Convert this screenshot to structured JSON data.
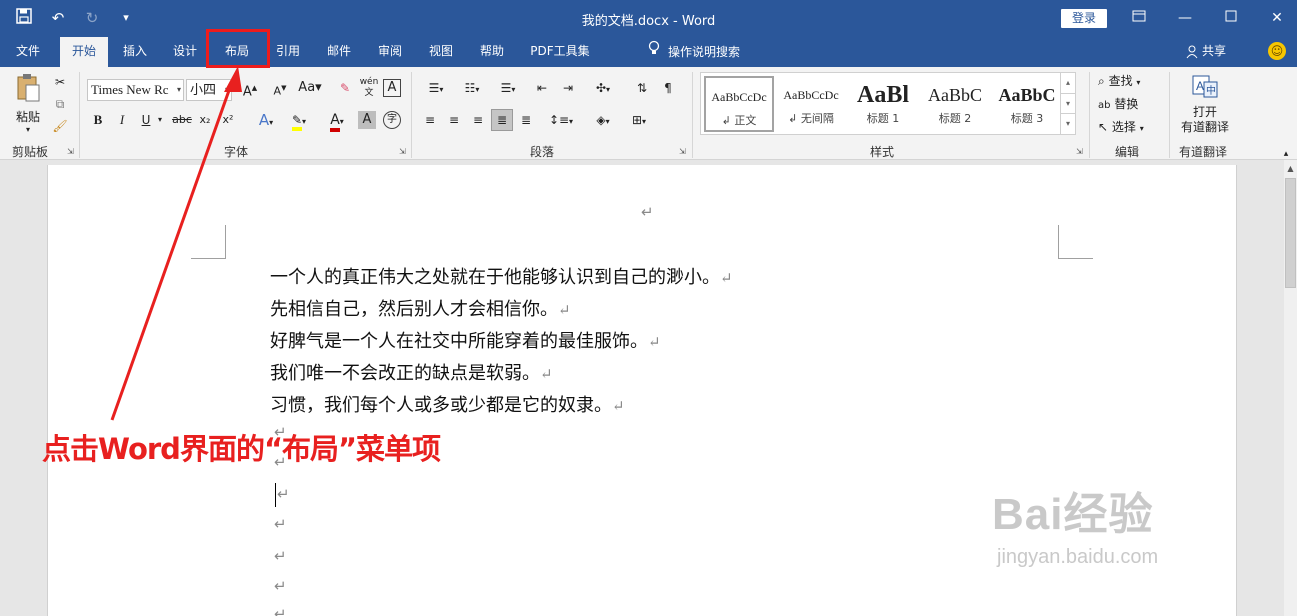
{
  "titlebar": {
    "title": "我的文档.docx  -  Word",
    "login_label": "登录",
    "qat": [
      "save-icon",
      "undo-icon",
      "redo-icon",
      "customize-icon"
    ]
  },
  "tabs": [
    {
      "label": "文件",
      "active": false
    },
    {
      "label": "开始",
      "active": true
    },
    {
      "label": "插入",
      "active": false
    },
    {
      "label": "设计",
      "active": false
    },
    {
      "label": "布局",
      "active": false
    },
    {
      "label": "引用",
      "active": false
    },
    {
      "label": "邮件",
      "active": false
    },
    {
      "label": "审阅",
      "active": false
    },
    {
      "label": "视图",
      "active": false
    },
    {
      "label": "帮助",
      "active": false
    },
    {
      "label": "PDF工具集",
      "active": false
    }
  ],
  "tell_me": "操作说明搜索",
  "share_label": "共享",
  "ribbon": {
    "clipboard": {
      "paste_label": "粘贴",
      "group_label": "剪贴板"
    },
    "font": {
      "font_name": "Times New Rc",
      "font_size": "小四",
      "group_label": "字体",
      "wen_glyph": "wén",
      "wen_char": "文",
      "case_glyph": "Aa",
      "bold": "B",
      "italic": "I",
      "underline": "U",
      "strike": "abc",
      "sub": "x₂",
      "sup": "x²"
    },
    "paragraph": {
      "group_label": "段落"
    },
    "styles": {
      "group_label": "样式",
      "items": [
        {
          "sample": "AaBbCcDc",
          "name": "↲ 正文"
        },
        {
          "sample": "AaBbCcDc",
          "name": "↲ 无间隔"
        },
        {
          "sample": "AaBl",
          "name": "标题 1"
        },
        {
          "sample": "AaBbC",
          "name": "标题 2"
        },
        {
          "sample": "AaBbC",
          "name": "标题 3"
        }
      ]
    },
    "editing": {
      "find_label": "查找",
      "replace_label": "替换",
      "select_label": "选择",
      "group_label": "编辑"
    },
    "youdao": {
      "open_label": "打开",
      "translate_label": "有道翻译",
      "group_label": "有道翻译"
    }
  },
  "document": {
    "lines": [
      "一个人的真正伟大之处就在于他能够认识到自己的渺小。",
      "先相信自己，然后别人才会相信你。",
      "好脾气是一个人在社交中所能穿着的最佳服饰。",
      "我们唯一不会改正的缺点是软弱。",
      "习惯，我们每个人或多或少都是它的奴隶。"
    ],
    "para_mark": "↵"
  },
  "annotation": {
    "text": "点击Word界面的“布局”菜单项"
  },
  "watermark": {
    "brand": "Bai经验",
    "url": "jingyan.baidu.com"
  },
  "colors": {
    "accent": "#2b579a",
    "annotation": "#e8201f"
  }
}
